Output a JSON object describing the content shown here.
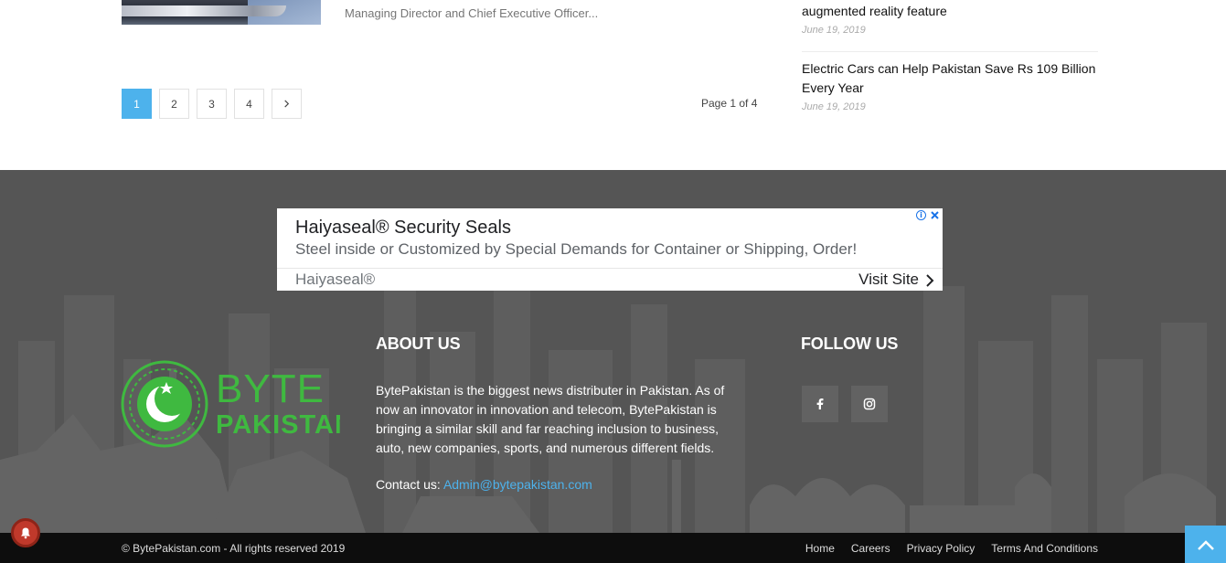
{
  "article": {
    "excerpt": "Managing Director and Chief Executive Officer..."
  },
  "pagination": {
    "pages": [
      "1",
      "2",
      "3",
      "4"
    ],
    "active": "1",
    "page_info": "Page 1 of 4"
  },
  "sidebar": {
    "items": [
      {
        "title": "augmented reality feature",
        "date": "June 19, 2019"
      },
      {
        "title": "Electric Cars can Help Pakistan Save Rs 109 Billion Every Year",
        "date": "June 19, 2019"
      }
    ]
  },
  "ad": {
    "title": "Haiyaseal® Security Seals",
    "description": "Steel inside or Customized by Special Demands for Container or Shipping, Order!",
    "brand": "Haiyaseal®",
    "cta": "Visit Site"
  },
  "footer": {
    "logo": {
      "line1": "BYTE",
      "line2": "PAKISTAN"
    },
    "about": {
      "heading": "ABOUT US",
      "text": "BytePakistan is the biggest news distributer in Pakistan. As of now an innovator in innovation and telecom, BytePakistan is bringing a similar skill and far reaching inclusion to business, auto, new companies, sports, and numerous different fields.",
      "contact_label": "Contact us: ",
      "contact_email": "Admin@bytepakistan.com"
    },
    "follow": {
      "heading": "FOLLOW US",
      "icons": [
        "facebook-icon",
        "instagram-icon"
      ]
    }
  },
  "bottom_bar": {
    "copyright": "© BytePakistan.com - All rights reserved 2019",
    "menu": [
      "Home",
      "Careers",
      "Privacy Policy",
      "Terms And Conditions"
    ]
  },
  "colors": {
    "accent": "#4db2ec",
    "footer_bg": "#555555",
    "bottom_bg": "#0d0d0d",
    "logo_green": "#3fb940"
  }
}
